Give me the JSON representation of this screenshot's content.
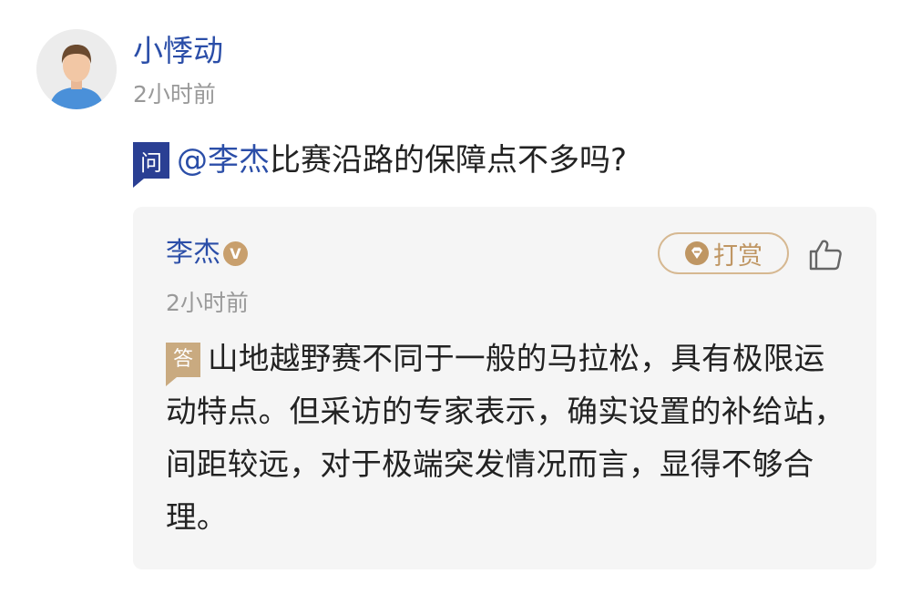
{
  "user": {
    "name": "小悸动",
    "time": "2小时前"
  },
  "question": {
    "badge": "问",
    "mention": "@李杰",
    "text": "比赛沿路的保障点不多吗?"
  },
  "answer": {
    "author": "李杰",
    "verified_badge": "V",
    "time": "2小时前",
    "tip_label": "打赏",
    "badge": "答",
    "text": "山地越野赛不同于一般的马拉松，具有极限运动特点。但采访的专家表示，确实设置的补给站，间距较远，对于极端突发情况而言，显得不够合理。"
  },
  "colors": {
    "link_blue": "#2b4ea8",
    "question_badge": "#2a3f93",
    "answer_badge": "#c9aa80",
    "tip_gold": "#bf9663",
    "muted": "#999999"
  },
  "icons": {
    "avatar": "user-avatar-icon",
    "verified": "verified-v-icon",
    "tip": "reward-diamond-icon",
    "like": "thumbs-up-icon"
  }
}
